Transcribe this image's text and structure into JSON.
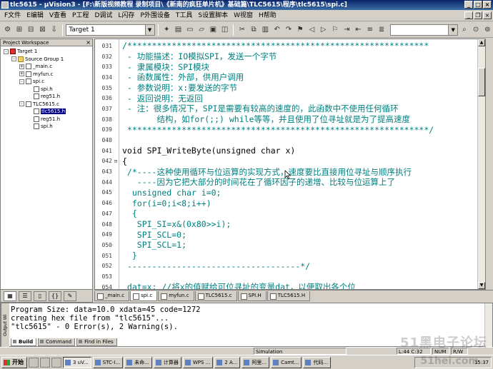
{
  "window": {
    "title": "tlc5615 - µVision3 - [F:\\新版视频教程 录制项目\\《新南的疯狂单片机》基础篇\\TLC5615\\程序\\tlc5615\\spi.c]"
  },
  "menu": {
    "items": [
      "F文件",
      "E编辑",
      "V查看",
      "P工程",
      "D调试",
      "L闪存",
      "P外围设备",
      "T工具",
      "S设置脚本",
      "W视窗",
      "H帮助"
    ]
  },
  "toolbar": {
    "target": "Target 1"
  },
  "workspace": {
    "title": "Project Workspace",
    "tree": [
      {
        "label": "Target 1",
        "level": 0,
        "kind": "target",
        "expander": "-"
      },
      {
        "label": "Source Group 1",
        "level": 1,
        "kind": "folder",
        "expander": "-"
      },
      {
        "label": "_main.c",
        "level": 2,
        "kind": "file",
        "expander": "+"
      },
      {
        "label": "myfun.c",
        "level": 2,
        "kind": "file",
        "expander": "+"
      },
      {
        "label": "spi.c",
        "level": 2,
        "kind": "file",
        "expander": "-"
      },
      {
        "label": "spi.h",
        "level": 3,
        "kind": "file",
        "expander": ""
      },
      {
        "label": "reg51.h",
        "level": 3,
        "kind": "file",
        "expander": ""
      },
      {
        "label": "TLC5615.c",
        "level": 2,
        "kind": "file",
        "expander": "-"
      },
      {
        "label": "tlc5615.h",
        "level": 3,
        "kind": "file",
        "expander": "",
        "selected": true
      },
      {
        "label": "reg51.h",
        "level": 3,
        "kind": "file",
        "expander": ""
      },
      {
        "label": "spi.h",
        "level": 3,
        "kind": "file",
        "expander": ""
      }
    ]
  },
  "editor": {
    "lines": [
      {
        "n": "031",
        "fold": "",
        "text": "/*************************************************************",
        "cls": "cm"
      },
      {
        "n": "032",
        "fold": "",
        "text": " - 功能描述：IO模拟SPI，发送一个字节",
        "cls": "cm"
      },
      {
        "n": "033",
        "fold": "",
        "text": " - 隶属模块：SPI模块",
        "cls": "cm"
      },
      {
        "n": "034",
        "fold": "",
        "text": " - 函数属性：外部，供用户调用",
        "cls": "cm"
      },
      {
        "n": "035",
        "fold": "",
        "text": " - 参数说明：x:要发送的字节",
        "cls": "cm"
      },
      {
        "n": "036",
        "fold": "",
        "text": " - 返回说明：无返回",
        "cls": "cm"
      },
      {
        "n": "037",
        "fold": "",
        "text": " - 注：很多情况下，SPI是需要有较高的速度的，此函数中不使用任何循环",
        "cls": "cm"
      },
      {
        "n": "038",
        "fold": "",
        "text": "       结构，如for(;;) while等等，并且使用了位寻址就是为了提高速度",
        "cls": "cm"
      },
      {
        "n": "039",
        "fold": "",
        "text": " *************************************************************/",
        "cls": "cm"
      },
      {
        "n": "040",
        "fold": "",
        "text": "",
        "cls": "kw"
      },
      {
        "n": "041",
        "fold": "",
        "text": "void SPI_WriteByte(unsigned char x)",
        "cls": "kw"
      },
      {
        "n": "042",
        "fold": "⊟",
        "text": "{",
        "cls": "kw"
      },
      {
        "n": "043",
        "fold": "",
        "text": " /*----这种使用循环与位运算的实现方式，速度要比直接用位寻址与顺序执行",
        "cls": "cm"
      },
      {
        "n": "044",
        "fold": "",
        "text": "   ----因为它把大部分的时间花在了循环因子的递增、比较与位运算上了",
        "cls": "cm"
      },
      {
        "n": "045",
        "fold": "",
        "text": "  unsigned char i=0;",
        "cls": "cm"
      },
      {
        "n": "046",
        "fold": "",
        "text": "  for(i=0;i<8;i++)",
        "cls": "cm"
      },
      {
        "n": "047",
        "fold": "",
        "text": "  {",
        "cls": "cm"
      },
      {
        "n": "048",
        "fold": "",
        "text": "   SPI_SI=x&(0x80>>i);",
        "cls": "cm"
      },
      {
        "n": "049",
        "fold": "",
        "text": "   SPI_SCL=0;",
        "cls": "cm"
      },
      {
        "n": "050",
        "fold": "",
        "text": "   SPI_SCL=1;",
        "cls": "cm"
      },
      {
        "n": "051",
        "fold": "",
        "text": "  }",
        "cls": "cm"
      },
      {
        "n": "052",
        "fold": "",
        "text": " -----------------------------------*/",
        "cls": "cm"
      },
      {
        "n": "053",
        "fold": "",
        "text": "",
        "cls": "kw"
      },
      {
        "n": "054",
        "fold": "",
        "text": " dat=x; //将x的值赋给可位寻址的变量dat，以便取出各个位",
        "cls": "cm"
      }
    ]
  },
  "file_tabs": [
    {
      "label": "_main.c",
      "active": false
    },
    {
      "label": "spi.c",
      "active": true
    },
    {
      "label": "myfun.c",
      "active": false
    },
    {
      "label": "TLC5615.c",
      "active": false
    },
    {
      "label": "SPI.H",
      "active": false
    },
    {
      "label": "TLC5615.H",
      "active": false
    }
  ],
  "output": {
    "side_label": "Output Wi",
    "lines": [
      "Program Size: data=10.0 xdata=45 code=1272",
      "creating hex file from \"tlc5615\"...",
      "\"tlc5615\" - 0 Error(s), 2 Warning(s)."
    ],
    "tabs": [
      {
        "label": "Build",
        "active": true
      },
      {
        "label": "Command",
        "active": false
      },
      {
        "label": "Find in Files",
        "active": false
      }
    ]
  },
  "status": {
    "mode": "Simulation",
    "position": "L:44 C:32",
    "num": "NUM",
    "rw": "R/W"
  },
  "taskbar": {
    "start": "开始",
    "buttons": [
      {
        "label": "3 uV...",
        "active": true
      },
      {
        "label": "STC-I...",
        "active": false
      },
      {
        "label": "未命...",
        "active": false
      },
      {
        "label": "计算器",
        "active": false
      },
      {
        "label": "WPS ...",
        "active": false
      },
      {
        "label": "2 A...",
        "active": false
      },
      {
        "label": "阿里...",
        "active": false
      },
      {
        "label": "Camt...",
        "active": false
      },
      {
        "label": "代码...",
        "active": false
      }
    ],
    "clock": "15:37"
  },
  "watermark": {
    "line1": "51黑电子论坛",
    "line2": "51hei.com"
  }
}
